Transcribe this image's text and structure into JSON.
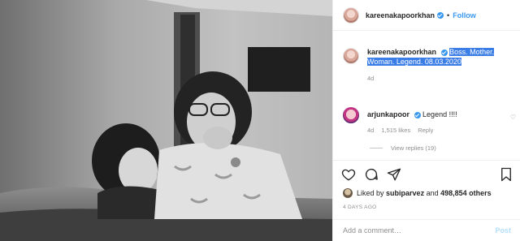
{
  "post": {
    "username": "kareenakapoorkhan",
    "separator": "•",
    "follow_label": "Follow",
    "caption": {
      "username": "kareenakapoorkhan",
      "text": "Boss. Mother. Woman. Legend. 08.03.2020",
      "age": "4d"
    },
    "comments": [
      {
        "username": "arjunkapoor",
        "text": "Legend !!!!",
        "age": "4d",
        "likes": "1,515 likes",
        "reply_label": "Reply",
        "view_replies": "View replies (19)"
      }
    ],
    "likes_line": {
      "prefix": "Liked by",
      "user": "subiparvez",
      "conj": "and",
      "others": "498,854 others"
    },
    "timestamp": "4 DAYS AGO",
    "add_comment_placeholder": "Add a comment…",
    "post_label": "Post"
  },
  "icons": {
    "verified": "verified-badge-icon",
    "like": "heart-icon",
    "comment": "comment-bubble-icon",
    "share": "paper-plane-icon",
    "save": "bookmark-icon",
    "comment_like": "small-heart-icon"
  },
  "colors": {
    "accent": "#3897f0",
    "highlight": "#3b7de6",
    "muted": "#8e8e8e",
    "post_disabled": "#b2dffc"
  }
}
